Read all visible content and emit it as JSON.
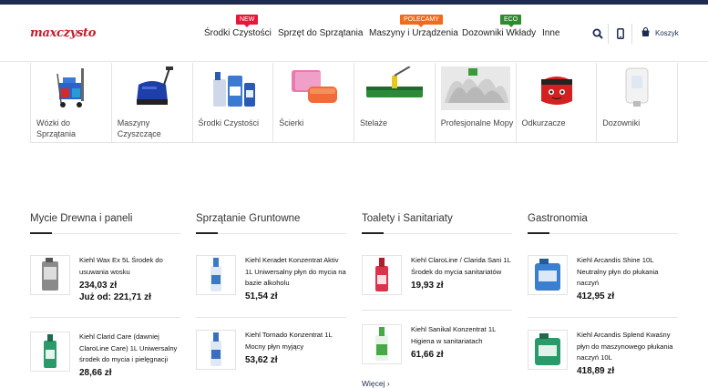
{
  "logo": "maxczysto",
  "nav": [
    {
      "label": "Środki Czystości",
      "badge": "NEW",
      "badge_color": "#e8173a"
    },
    {
      "label": "Sprzęt do Sprzątania"
    },
    {
      "label": "Maszyny i Urządzenia",
      "badge": "POLECAMY",
      "badge_color": "#f26b1d"
    },
    {
      "label": "Dozowniki Wkłady",
      "badge": "ECO",
      "badge_color": "#2e8b2e"
    },
    {
      "label": "Inne"
    }
  ],
  "header": {
    "search_icon": "search-icon",
    "phone_icon": "phone-icon",
    "cart_icon": "cart-icon",
    "cart_label": "Koszyk"
  },
  "categories": [
    {
      "label": "Wózki do Sprzątania",
      "icon": "cleaning-cart-image"
    },
    {
      "label": "Maszyny Czyszczące",
      "icon": "scrubber-machine-image"
    },
    {
      "label": "Środki Czystości",
      "icon": "detergent-bottles-image"
    },
    {
      "label": "Ścierki",
      "icon": "cloths-image"
    },
    {
      "label": "Stelaże",
      "icon": "mop-frame-image"
    },
    {
      "label": "Profesjonalne Mopy",
      "icon": "mops-image"
    },
    {
      "label": "Odkurzacze",
      "icon": "vacuum-image"
    },
    {
      "label": "Dozowniki",
      "icon": "dispenser-image"
    }
  ],
  "columns": [
    {
      "title": "Mycie Drewna i paneli",
      "products": [
        {
          "name": "Kiehl Wax Ex 5L Środek do usuwania wosku",
          "price": "234,03 zł",
          "price2": "Już od: 221,71 zł",
          "color": "#8a8a8a"
        },
        {
          "name": "Kiehl Clarid Care (dawniej ClaroLine Care) 1L Uniwersalny środek do mycia i pielęgnacji",
          "price": "28,66 zł",
          "color": "#2b9a6a"
        }
      ]
    },
    {
      "title": "Sprzątanie Gruntowne",
      "products": [
        {
          "name": "Kiehl Keradet Konzentrat Aktiv 1L Uniwersalny płyn do mycia na bazie alkoholu",
          "price": "51,54 zł",
          "color": "#3a78c8"
        },
        {
          "name": "Kiehl Tornado Konzentrat 1L Mocny płyn myjący",
          "price": "53,62 zł",
          "color": "#3a6fc0"
        }
      ]
    },
    {
      "title": "Toalety i Sanitariaty",
      "products": [
        {
          "name": "Kiehl ClaroLine / Clarida Sani 1L Środek do mycia sanitariatów",
          "price": "19,93 zł",
          "color": "#d8344a"
        },
        {
          "name": "Kiehl Sanikal Konzentrat 1L Higiena w sanitariatach",
          "price": "61,66 zł",
          "color": "#48a848"
        }
      ],
      "more": "Więcej ›"
    },
    {
      "title": "Gastronomia",
      "products": [
        {
          "name": "Kiehl Arcandis Shine 10L Neutralny płyn do płukania naczyń",
          "price": "412,95 zł",
          "color": "#3a7fd0"
        },
        {
          "name": "Kiehl Arcandis Splend Kwaśny płyn do maszynowego płukania naczyń 10L",
          "price": "418,89 zł",
          "color": "#2a9a6a"
        }
      ]
    }
  ]
}
